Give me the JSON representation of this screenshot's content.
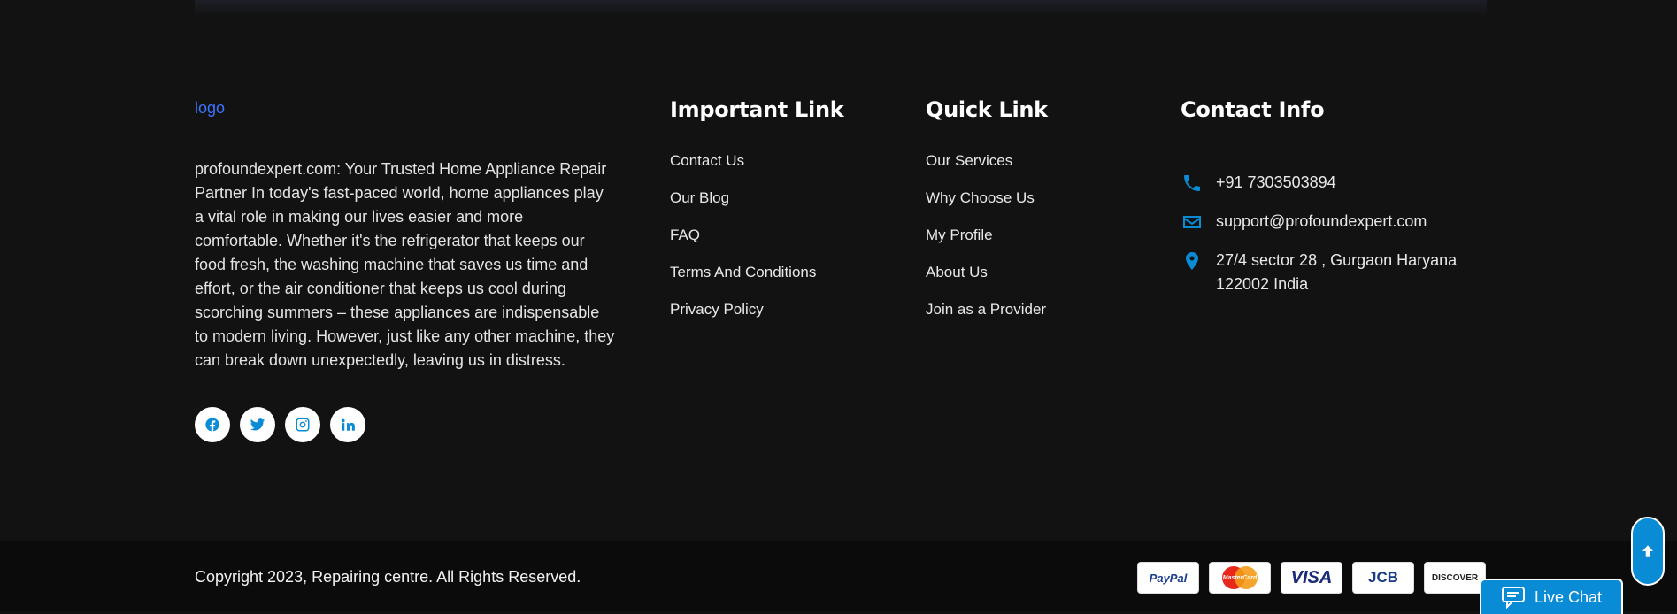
{
  "logo": {
    "alt": "logo"
  },
  "about": {
    "text": "profoundexpert.com: Your Trusted Home Appliance Repair Partner In today's fast-paced world, home appliances play a vital role in making our lives easier and more comfortable. Whether it's the refrigerator that keeps our food fresh, the washing machine that saves us time and effort, or the air conditioner that keeps us cool during scorching summers – these appliances are indispensable to modern living. However, just like any other machine, they can break down unexpectedly, leaving us in distress."
  },
  "socials": [
    "facebook-icon",
    "twitter-icon",
    "instagram-icon",
    "linkedin-icon"
  ],
  "important_links": {
    "title": "Important Link",
    "items": [
      "Contact Us",
      "Our Blog",
      "FAQ",
      "Terms And Conditions",
      "Privacy Policy"
    ]
  },
  "quick_links": {
    "title": "Quick Link",
    "items": [
      "Our Services",
      "Why Choose Us",
      "My Profile",
      "About Us",
      "Join as a Provider"
    ]
  },
  "contact": {
    "title": "Contact Info",
    "phone": "+91 7303503894",
    "email": "support@profoundexpert.com",
    "address_line1": "27/4 sector 28 , Gurgaon Haryana",
    "address_line2": "122002 India"
  },
  "bottom": {
    "copyright": "Copyright 2023, Repairing centre. All Rights Reserved.",
    "payments": {
      "paypal": "PayPal",
      "mastercard": "MasterCard",
      "visa": "VISA",
      "jcb": "JCB",
      "discover": "DISCOVER"
    }
  },
  "live_chat": {
    "label": "Live Chat"
  },
  "colors": {
    "accent": "#0a8bd6",
    "background": "#121212",
    "bottom_bar": "#0b0b0b"
  }
}
